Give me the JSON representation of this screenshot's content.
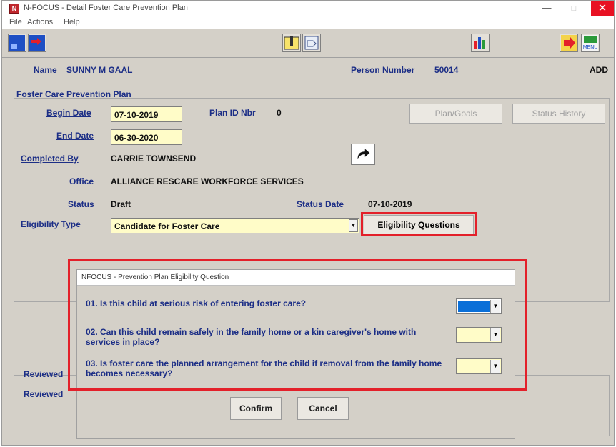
{
  "window": {
    "title": "N-FOCUS - Detail Foster Care Prevention Plan",
    "app_icon_letter": "N",
    "minimize": "—",
    "maximize": "□",
    "close": "✕"
  },
  "menu": [
    "File",
    "Actions",
    "Help"
  ],
  "toolbar": {
    "icons": [
      "window-left-icon",
      "window-exit-icon",
      "notes-icon",
      "tag-icon",
      "bar-chart-icon",
      "next-icon",
      "menu-icon"
    ],
    "menu_icon_text": "MENU"
  },
  "header": {
    "name_label": "Name",
    "name_value": "SUNNY M GAAL",
    "person_number_label": "Person Number",
    "person_number_value": "50014",
    "mode": "ADD"
  },
  "plan": {
    "group_title": "Foster Care Prevention Plan",
    "begin_date_label": "Begin Date",
    "begin_date_value": "07-10-2019",
    "plan_id_label": "Plan ID Nbr",
    "plan_id_value": "0",
    "end_date_label": "End Date",
    "end_date_value": "06-30-2020",
    "completed_by_label": "Completed By",
    "completed_by_value": "CARRIE TOWNSEND",
    "office_label": "Office",
    "office_value": "ALLIANCE RESCARE WORKFORCE SERVICES",
    "status_label": "Status",
    "status_value": "Draft",
    "status_date_label": "Status Date",
    "status_date_value": "07-10-2019",
    "eligibility_type_label": "Eligibility Type",
    "eligibility_type_value": "Candidate for Foster Care",
    "plan_goals_button": "Plan/Goals",
    "status_history_button": "Status History",
    "eligibility_questions_button": "Eligibility Questions"
  },
  "reviewed": {
    "label1": "Reviewed",
    "label2": "Reviewed"
  },
  "dialog": {
    "title": "NFOCUS - Prevention Plan Eligibility Question",
    "questions": [
      "01. Is this child at serious risk of entering foster care?",
      "02. Can this child remain safely in the family home or a kin caregiver's home with services in place?",
      "03. Is foster care the planned arrangement for the child if removal from the family home becomes necessary?"
    ],
    "confirm_button": "Confirm",
    "cancel_button": "Cancel"
  },
  "colors": {
    "label_blue": "#1c2e86",
    "highlight_red": "#e3202a",
    "field_yellow": "#fffcc8",
    "selected_blue": "#0a6fd8"
  }
}
